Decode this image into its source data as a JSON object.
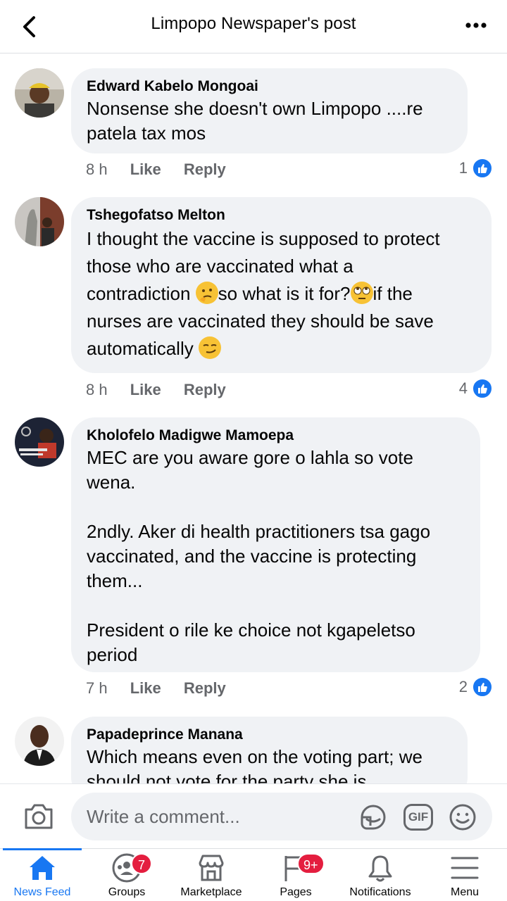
{
  "header": {
    "title": "Limpopo Newspaper's post",
    "back_icon": "chevron-left-icon",
    "more_icon": "more-horizontal-icon"
  },
  "comments": [
    {
      "author": "Edward Kabelo Mongoai",
      "text": "Nonsense she doesn't own Limpopo ....re\npatela tax mos",
      "time": "8 h",
      "like_label": "Like",
      "reply_label": "Reply",
      "reactions": "1"
    },
    {
      "author": "Tshegofatso Melton",
      "text_parts": [
        "I thought the vaccine is supposed to protect\nthose who are vaccinated what a\ncontradiction ",
        "so what is it for?",
        "if the\nnurses are vaccinated they should be save\nautomatically "
      ],
      "emojis": [
        "thinking-face-emoji",
        "rolling-eyes-emoji",
        "smirking-face-emoji"
      ],
      "time": "8 h",
      "like_label": "Like",
      "reply_label": "Reply",
      "reactions": "4"
    },
    {
      "author": "Kholofelo Madigwe Mamoepa",
      "text": "MEC are you aware gore o lahla so vote\nwena.\n\n2ndly. Aker di health practitioners tsa gago\nvaccinated,  and the vaccine is protecting\nthem...\n\nPresident o rile ke choice not kgapeletso\nperiod",
      "time": "7 h",
      "like_label": "Like",
      "reply_label": "Reply",
      "reactions": "2"
    },
    {
      "author": "Papadeprince Manana",
      "text": "Which means even on the voting part; we\nshould not vote for the party she is"
    }
  ],
  "composer": {
    "placeholder": "Write a comment...",
    "camera_icon": "camera-icon",
    "sticker_icon": "sticker-icon",
    "gif_label": "GIF",
    "emoji_icon": "emoji-icon"
  },
  "nav": [
    {
      "label": "News Feed",
      "icon": "home-icon",
      "active": true
    },
    {
      "label": "Groups",
      "icon": "groups-icon",
      "badge": "7"
    },
    {
      "label": "Marketplace",
      "icon": "marketplace-icon"
    },
    {
      "label": "Pages",
      "icon": "pages-icon",
      "badge": "9+"
    },
    {
      "label": "Notifications",
      "icon": "bell-icon"
    },
    {
      "label": "Menu",
      "icon": "menu-icon"
    }
  ],
  "colors": {
    "accent": "#1877f2",
    "bubble": "#f0f2f5",
    "muted": "#65676b",
    "badge": "#e41e3f"
  }
}
